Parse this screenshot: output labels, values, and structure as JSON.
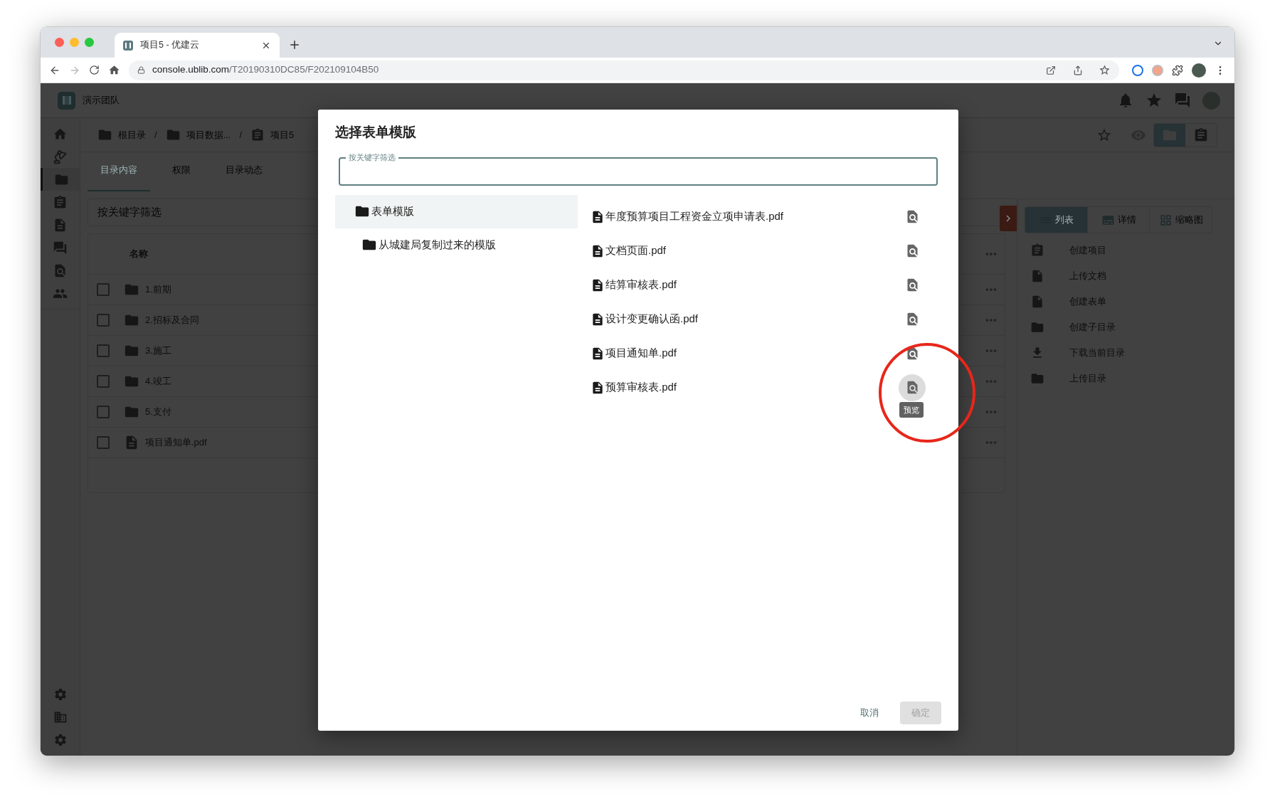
{
  "browser": {
    "tab_title": "项目5 - 优建云",
    "url_host": "console.ublib.com",
    "url_path": "/T20190310DC85/F202109104B50"
  },
  "app": {
    "team": "演示团队"
  },
  "sidebar": {
    "items": [
      {
        "kind": "home",
        "selected": false
      },
      {
        "kind": "lamp",
        "selected": false
      },
      {
        "kind": "folder",
        "selected": true
      },
      {
        "kind": "clipboard",
        "selected": false
      },
      {
        "kind": "document",
        "selected": false
      },
      {
        "kind": "chat",
        "selected": false
      },
      {
        "kind": "search",
        "selected": false
      },
      {
        "kind": "people",
        "selected": false
      }
    ],
    "bottom": [
      {
        "kind": "settings"
      },
      {
        "kind": "building"
      },
      {
        "kind": "settings"
      }
    ]
  },
  "breadcrumb": [
    {
      "label": "根目录",
      "kind": "folder"
    },
    {
      "separator": "/",
      "label": "项目数据...",
      "kind": "folder"
    },
    {
      "separator": "/",
      "label": "项目5",
      "kind": "project"
    }
  ],
  "view_toggle": [
    {
      "kind": "folder",
      "selected": true
    },
    {
      "kind": "clipboard",
      "selected": false
    }
  ],
  "tabs": [
    {
      "label": "目录内容",
      "selected": true
    },
    {
      "label": "权限",
      "selected": false
    },
    {
      "label": "目录动态",
      "selected": false
    }
  ],
  "filter": {
    "placeholder": "按关键字筛选"
  },
  "table": {
    "columns": [
      "名称"
    ],
    "rows": [
      {
        "name": "1.前期",
        "kind": "folder",
        "checked": false
      },
      {
        "name": "2.招标及合同",
        "kind": "folder",
        "checked": false
      },
      {
        "name": "3.施工",
        "kind": "folder",
        "checked": false
      },
      {
        "name": "4.竣工",
        "kind": "folder",
        "checked": false
      },
      {
        "name": "5.支付",
        "kind": "folder",
        "checked": false
      },
      {
        "name": "项目通知单.pdf",
        "kind": "file",
        "checked": false
      }
    ]
  },
  "view_tabs": [
    {
      "label": "列表",
      "kind": "list",
      "selected": true
    },
    {
      "label": "详情",
      "kind": "details",
      "selected": false
    },
    {
      "label": "缩略图",
      "kind": "grid",
      "selected": false
    }
  ],
  "actions": [
    {
      "label": "创建项目",
      "kind": "clipboard"
    },
    {
      "label": "上传文档",
      "kind": "file"
    },
    {
      "label": "创建表单",
      "kind": "file"
    },
    {
      "label": "创建子目录",
      "kind": "folder"
    },
    {
      "label": "下载当前目录",
      "kind": "download"
    },
    {
      "label": "上传目录",
      "kind": "folder"
    }
  ],
  "dialog": {
    "title": "选择表单模版",
    "filter": {
      "label": "按关键字筛选"
    },
    "tree": [
      {
        "label": "表单模版",
        "selected": true,
        "children": [
          {
            "label": "从城建局复制过来的模版",
            "selected": false
          }
        ]
      }
    ],
    "files": [
      {
        "name": "年度预算项目工程资金立项申请表.pdf",
        "hovered": false
      },
      {
        "name": "文档页面.pdf",
        "hovered": false
      },
      {
        "name": "结算审核表.pdf",
        "hovered": false
      },
      {
        "name": "设计变更确认函.pdf",
        "hovered": false
      },
      {
        "name": "项目通知单.pdf",
        "hovered": false
      },
      {
        "name": "预算审核表.pdf",
        "hovered": true
      }
    ],
    "tooltip": "预览",
    "buttons": [
      {
        "label": "取消",
        "disabled": false
      },
      {
        "label": "确定",
        "disabled": true
      }
    ]
  }
}
